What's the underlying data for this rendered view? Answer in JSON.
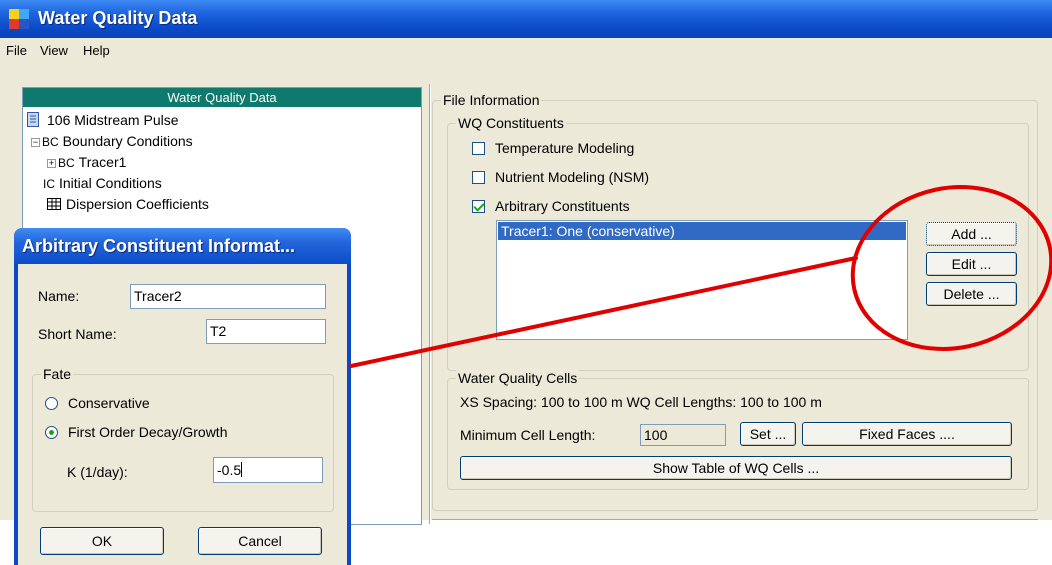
{
  "window": {
    "title": "Water Quality Data"
  },
  "menu": [
    "File",
    "View",
    "Help"
  ],
  "tree": {
    "header": "Water Quality Data",
    "items": [
      {
        "tag": "",
        "label": "106 Midstream Pulse"
      },
      {
        "tag": "BC",
        "label": "Boundary Conditions"
      },
      {
        "tag": "BC",
        "label": "Tracer1"
      },
      {
        "tag": "IC",
        "label": "Initial Conditions"
      },
      {
        "tag": "",
        "label": "Dispersion Coefficients"
      }
    ]
  },
  "file_info": {
    "legend": "File Information",
    "constituents": {
      "legend": "WQ Constituents",
      "options": [
        {
          "label": "Temperature Modeling",
          "checked": false
        },
        {
          "label": "Nutrient Modeling (NSM)",
          "checked": false
        },
        {
          "label": "Arbitrary Constituents",
          "checked": true
        }
      ],
      "list": [
        "Tracer1: One  (conservative)"
      ],
      "buttons": {
        "add": "Add ...",
        "edit": "Edit ...",
        "delete": "Delete ..."
      }
    },
    "cells": {
      "legend": "Water Quality Cells",
      "summary": "XS Spacing: 100 to 100 m   WQ Cell Lengths: 100 to 100 m",
      "min_label": "Minimum Cell Length:",
      "min_value": "100",
      "set_button": "Set ...",
      "fixed_button": "Fixed Faces ....",
      "table_button": "Show Table of WQ Cells ..."
    }
  },
  "dialog": {
    "title": "Arbitrary Constituent Informat...",
    "name_label": "Name:",
    "name_value": "Tracer2",
    "short_label": "Short Name:",
    "short_value": "T2",
    "fate": {
      "legend": "Fate",
      "options": [
        {
          "label": "Conservative",
          "selected": false
        },
        {
          "label": "First Order Decay/Growth",
          "selected": true
        }
      ],
      "k_label": "K (1/day):",
      "k_value": "-0.5"
    },
    "ok": "OK",
    "cancel": "Cancel"
  },
  "colors": {
    "titlebar": "#0a4ac8",
    "tree_header": "#0e7a6e",
    "selection": "#316ac5",
    "annotation": "#e00000"
  }
}
